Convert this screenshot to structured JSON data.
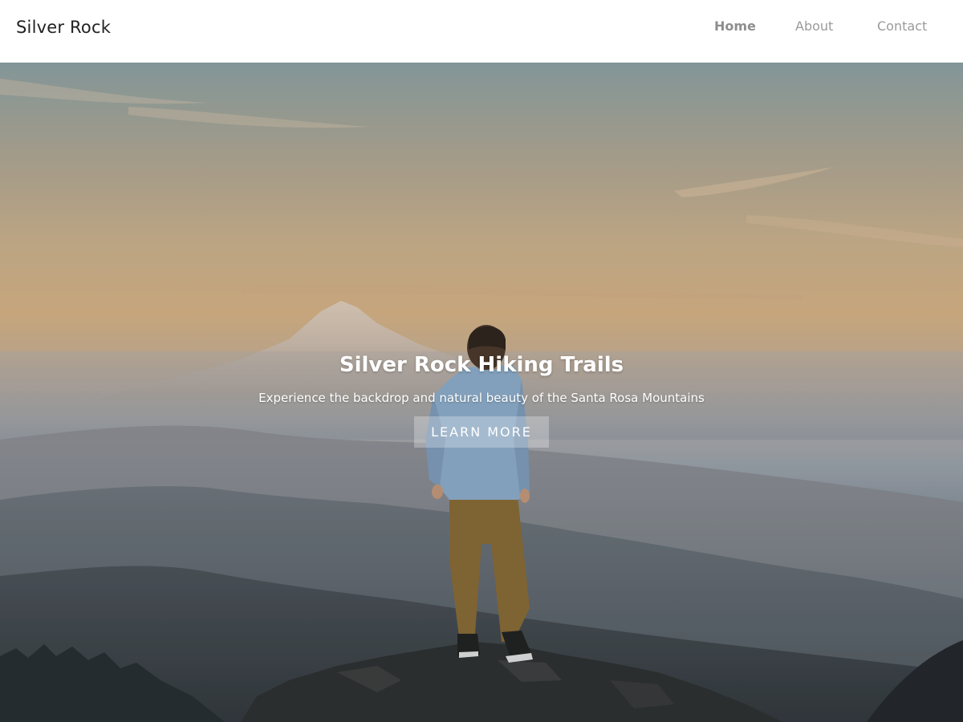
{
  "brand": {
    "name": "Silver Rock"
  },
  "nav": {
    "items": [
      {
        "label": "Home",
        "active": true
      },
      {
        "label": "About",
        "active": false
      },
      {
        "label": "Contact",
        "active": false
      }
    ]
  },
  "hero": {
    "title": "Silver Rock Hiking Trails",
    "subtitle": "Experience the backdrop and natural beauty of the Santa Rosa Mountains",
    "button_label": "LEARN MORE",
    "image": "hiker standing on rock summit overlooking misty mountains at sunset"
  },
  "colors": {
    "nav_text": "#9a9a9a",
    "brand_text": "#222222",
    "hero_text": "#ffffff"
  }
}
